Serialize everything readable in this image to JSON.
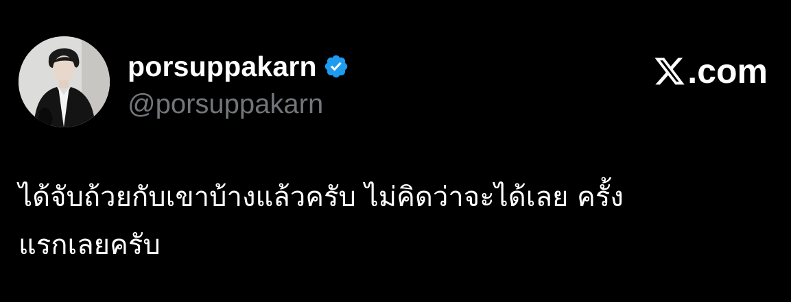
{
  "author": {
    "display_name": "porsuppakarn",
    "handle": "@porsuppakarn",
    "verified": true,
    "avatar_icon": "profile-photo"
  },
  "brand": {
    "text": ".com",
    "logo_icon": "x-logo-icon"
  },
  "tweet": {
    "text": "ได้จับถ้วยกับเขาบ้างแล้วครับ ไม่คิดว่าจะได้เลย ครั้ง\nแรกเลยครับ"
  },
  "colors": {
    "background": "#000000",
    "text_primary": "#ffffff",
    "text_secondary": "#71767b",
    "verified_badge": "#1d9bf0"
  }
}
